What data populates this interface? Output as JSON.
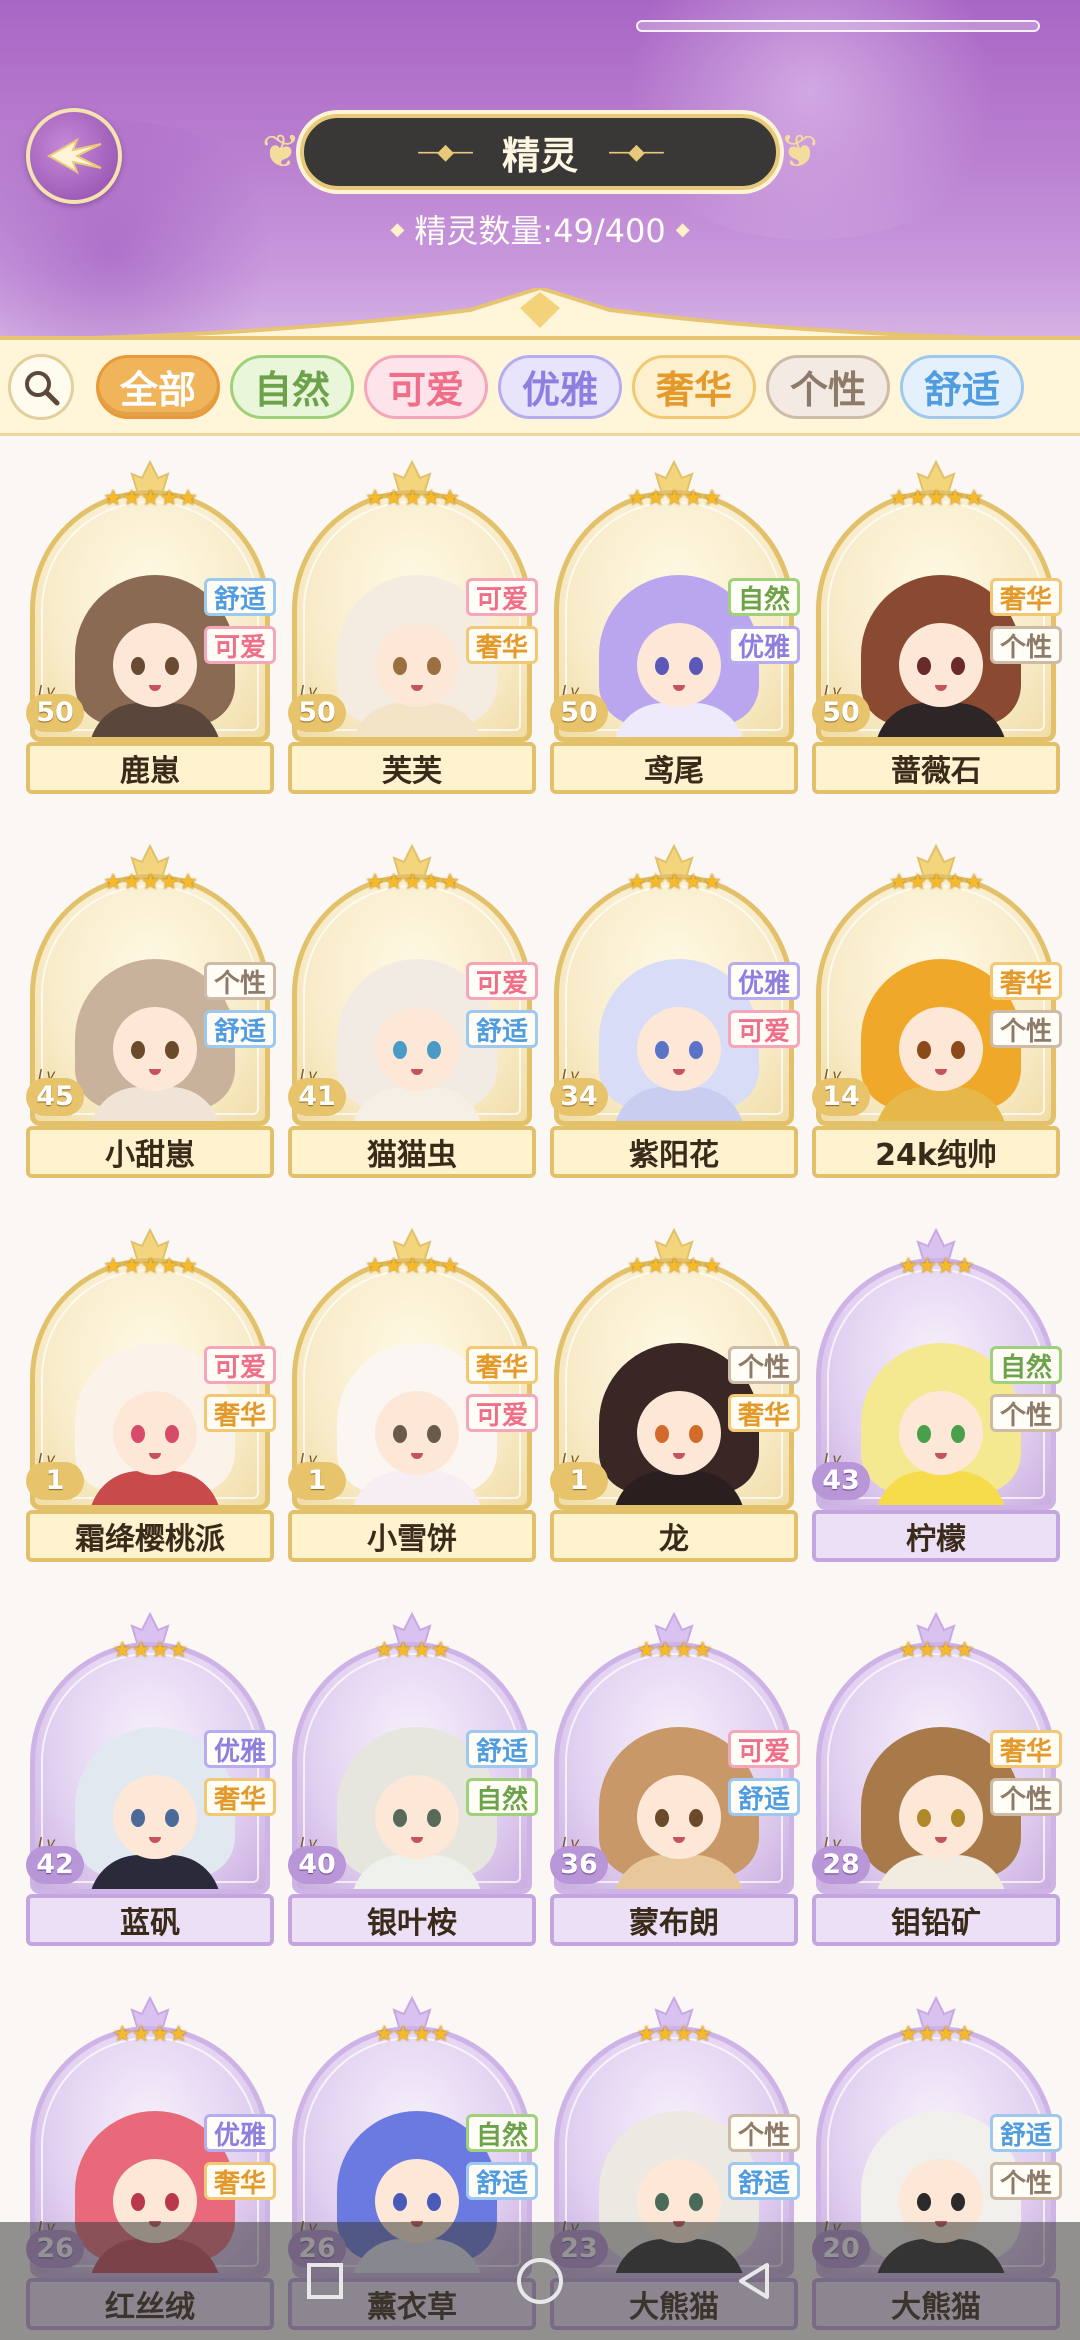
{
  "header": {
    "title": "精灵",
    "count_label": "精灵数量:49/400",
    "back_icon": "wing-arrow-icon"
  },
  "filters": {
    "search_icon": "search-icon",
    "tabs": [
      {
        "label": "全部",
        "bg": "#f0b55a",
        "fg": "#ffffff",
        "border": "#e89a3a",
        "active": true
      },
      {
        "label": "自然",
        "bg": "#eaf6da",
        "fg": "#6ca24a",
        "border": "#9fd07a"
      },
      {
        "label": "可爱",
        "bg": "#fde3ea",
        "fg": "#ef6f8a",
        "border": "#f6a6ba"
      },
      {
        "label": "优雅",
        "bg": "#e8e4fb",
        "fg": "#8d7ee0",
        "border": "#b6acf0"
      },
      {
        "label": "奢华",
        "bg": "#fdf0cf",
        "fg": "#e39a2a",
        "border": "#f2c874"
      },
      {
        "label": "个性",
        "bg": "#f3ebe3",
        "fg": "#8d7a68",
        "border": "#cdbba8"
      },
      {
        "label": "舒适",
        "bg": "#e4f1fd",
        "fg": "#4f9de0",
        "border": "#9dc8f0"
      }
    ]
  },
  "tag_styles": {
    "自然": {
      "fg": "#6ca24a",
      "border": "#9fd07a"
    },
    "可爱": {
      "fg": "#ef6f8a",
      "border": "#f6a6ba"
    },
    "优雅": {
      "fg": "#8d7ee0",
      "border": "#b6acf0"
    },
    "奢华": {
      "fg": "#e39a2a",
      "border": "#f2c874"
    },
    "个性": {
      "fg": "#8d7a68",
      "border": "#cdbba8"
    },
    "舒适": {
      "fg": "#4f9de0",
      "border": "#9dc8f0"
    }
  },
  "spirits": [
    {
      "name": "鹿崽",
      "level": "50",
      "stars": 5,
      "tags": [
        "舒适",
        "可爱"
      ],
      "tier": "gold",
      "hair": "#8a6a52",
      "eye": "#6b4a34",
      "body": "#5a463a"
    },
    {
      "name": "芙芙",
      "level": "50",
      "stars": 5,
      "tags": [
        "可爱",
        "奢华"
      ],
      "tier": "gold",
      "hair": "#f4ece0",
      "eye": "#9a7040",
      "body": "#f3e4c8"
    },
    {
      "name": "鸢尾",
      "level": "50",
      "stars": 5,
      "tags": [
        "自然",
        "优雅"
      ],
      "tier": "gold",
      "hair": "#b9a6ee",
      "eye": "#5b58b8",
      "body": "#eeeafc"
    },
    {
      "name": "蔷薇石",
      "level": "50",
      "stars": 5,
      "tags": [
        "奢华",
        "个性"
      ],
      "tier": "gold",
      "hair": "#8a4a32",
      "eye": "#6a2a2a",
      "body": "#2e2626"
    },
    {
      "name": "小甜崽",
      "level": "45",
      "stars": 5,
      "tags": [
        "个性",
        "舒适"
      ],
      "tier": "gold",
      "hair": "#c8b29c",
      "eye": "#6a4a2a",
      "body": "#efe4d6"
    },
    {
      "name": "猫猫虫",
      "level": "41",
      "stars": 5,
      "tags": [
        "可爱",
        "舒适"
      ],
      "tier": "gold",
      "hair": "#f2ebe4",
      "eye": "#4a9ac8",
      "body": "#f6efe6"
    },
    {
      "name": "紫阳花",
      "level": "34",
      "stars": 5,
      "tags": [
        "优雅",
        "可爱"
      ],
      "tier": "gold",
      "hair": "#d8dcf6",
      "eye": "#5a72c8",
      "body": "#c9cdf0"
    },
    {
      "name": "24k纯帅",
      "level": "14",
      "stars": 5,
      "tags": [
        "奢华",
        "个性"
      ],
      "tier": "gold",
      "hair": "#f0a82a",
      "eye": "#8a4a1a",
      "body": "#e6b84a"
    },
    {
      "name": "霜绛樱桃派",
      "level": "1",
      "stars": 5,
      "tags": [
        "可爱",
        "奢华"
      ],
      "tier": "gold",
      "hair": "#fbf2ea",
      "eye": "#d84a6a",
      "body": "#c84a4a"
    },
    {
      "name": "小雪饼",
      "level": "1",
      "stars": 5,
      "tags": [
        "奢华",
        "可爱"
      ],
      "tier": "gold",
      "hair": "#fbf6f2",
      "eye": "#6a5a4a",
      "body": "#f6eef2"
    },
    {
      "name": "龙",
      "level": "1",
      "stars": 5,
      "tags": [
        "个性",
        "奢华"
      ],
      "tier": "gold",
      "hair": "#3a2624",
      "eye": "#d46a2a",
      "body": "#2a1e1e"
    },
    {
      "name": "柠檬",
      "level": "43",
      "stars": 4,
      "tags": [
        "自然",
        "个性"
      ],
      "tier": "purple",
      "hair": "#f4e890",
      "eye": "#4aa04a",
      "body": "#f6dc4a"
    },
    {
      "name": "蓝矾",
      "level": "42",
      "stars": 4,
      "tags": [
        "优雅",
        "奢华"
      ],
      "tier": "purple",
      "hair": "#e2e8f0",
      "eye": "#4a6a9a",
      "body": "#2a2a3a"
    },
    {
      "name": "银叶桉",
      "level": "40",
      "stars": 4,
      "tags": [
        "舒适",
        "自然"
      ],
      "tier": "purple",
      "hair": "#e6e6de",
      "eye": "#5a6a5a",
      "body": "#eef2ea"
    },
    {
      "name": "蒙布朗",
      "level": "36",
      "stars": 4,
      "tags": [
        "可爱",
        "舒适"
      ],
      "tier": "purple",
      "hair": "#c89868",
      "eye": "#6a4a2a",
      "body": "#e8c89a"
    },
    {
      "name": "钼铅矿",
      "level": "28",
      "stars": 4,
      "tags": [
        "奢华",
        "个性"
      ],
      "tier": "purple",
      "hair": "#a87a4a",
      "eye": "#b08a2a",
      "body": "#f2ece0"
    },
    {
      "name": "红丝绒",
      "level": "26",
      "stars": 4,
      "tags": [
        "优雅",
        "奢华"
      ],
      "tier": "purple",
      "hair": "#e86a7a",
      "eye": "#b83a4a",
      "body": "#c84a5a"
    },
    {
      "name": "薰衣草",
      "level": "26",
      "stars": 4,
      "tags": [
        "自然",
        "舒适"
      ],
      "tier": "purple",
      "hair": "#6a7ae0",
      "eye": "#4a5ab8",
      "body": "#e2e2f4"
    },
    {
      "name": "大熊猫",
      "level": "23",
      "stars": 4,
      "tags": [
        "个性",
        "舒适"
      ],
      "tier": "purple",
      "hair": "#ece8e2",
      "eye": "#4a6a5a",
      "body": "#2a2a2a"
    },
    {
      "name": "大熊猫",
      "level": "20",
      "stars": 4,
      "tags": [
        "舒适",
        "个性"
      ],
      "tier": "purple",
      "hair": "#f2f0ec",
      "eye": "#2a2a2a",
      "body": "#2a2a2a"
    }
  ],
  "navbar": {
    "items": [
      {
        "icon": "recents-square-icon"
      },
      {
        "icon": "home-circle-icon"
      },
      {
        "icon": "back-triangle-icon"
      }
    ]
  }
}
